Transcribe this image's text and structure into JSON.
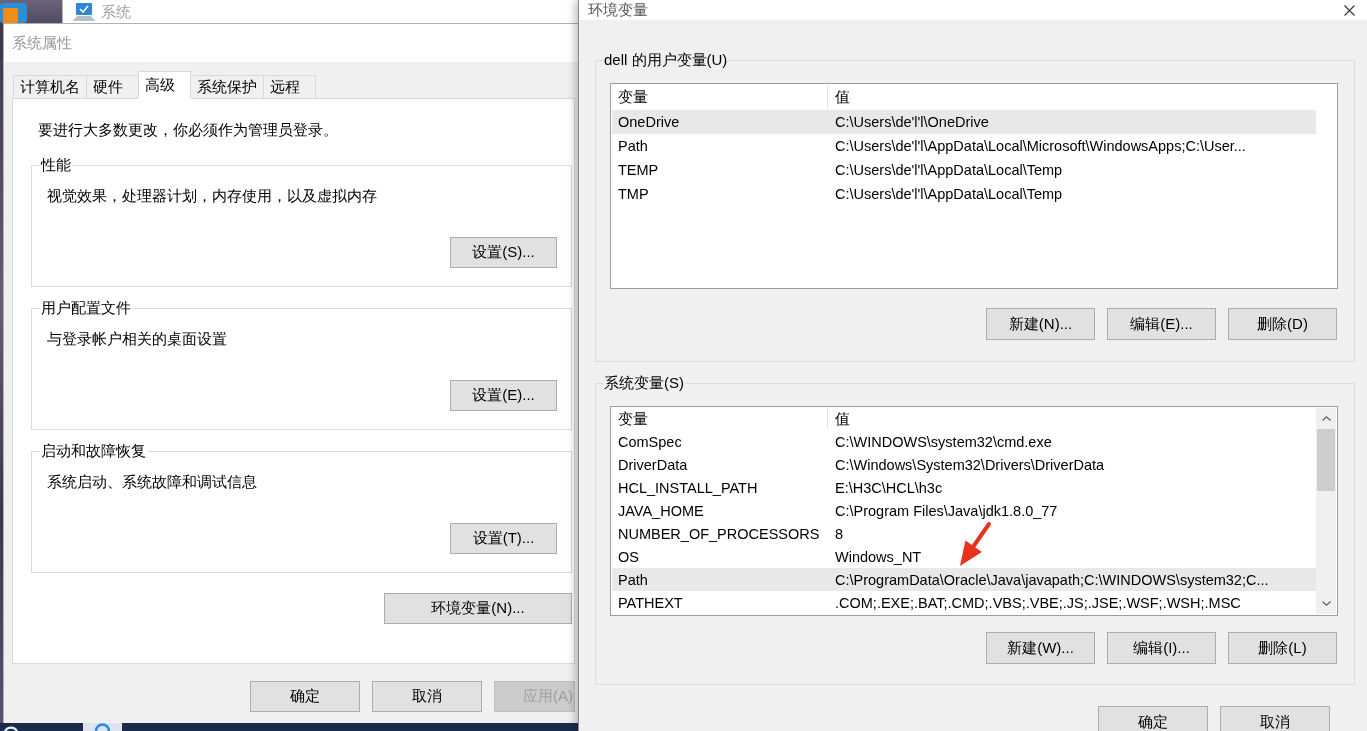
{
  "background_window": {
    "title": "系统"
  },
  "system_properties": {
    "title": "系统属性",
    "tabs": [
      {
        "label": "计算机名",
        "selected": false
      },
      {
        "label": "硬件",
        "selected": false
      },
      {
        "label": "高级",
        "selected": true
      },
      {
        "label": "系统保护",
        "selected": false
      },
      {
        "label": "远程",
        "selected": false
      }
    ],
    "notice": "要进行大多数更改，你必须作为管理员登录。",
    "groups": [
      {
        "title": "性能",
        "description": "视觉效果，处理器计划，内存使用，以及虚拟内存",
        "button": "设置(S)..."
      },
      {
        "title": "用户配置文件",
        "description": "与登录帐户相关的桌面设置",
        "button": "设置(E)..."
      },
      {
        "title": "启动和故障恢复",
        "description": "系统启动、系统故障和调试信息",
        "button": "设置(T)..."
      }
    ],
    "environment_button": "环境变量(N)...",
    "buttons": [
      {
        "label": "确定",
        "disabled": false
      },
      {
        "label": "取消",
        "disabled": false
      },
      {
        "label": "应用(A)",
        "disabled": true
      }
    ]
  },
  "environment_variables": {
    "title": "环境变量",
    "sections": [
      {
        "title": "dell 的用户变量(U)",
        "columns": [
          "变量",
          "值"
        ],
        "rows": [
          {
            "name": "OneDrive",
            "value": "C:\\Users\\de'l'l\\OneDrive",
            "selected": true
          },
          {
            "name": "Path",
            "value": "C:\\Users\\de'l'l\\AppData\\Local\\Microsoft\\WindowsApps;C:\\User...",
            "selected": false
          },
          {
            "name": "TEMP",
            "value": "C:\\Users\\de'l'l\\AppData\\Local\\Temp",
            "selected": false
          },
          {
            "name": "TMP",
            "value": "C:\\Users\\de'l'l\\AppData\\Local\\Temp",
            "selected": false
          }
        ],
        "buttons": [
          "新建(N)...",
          "编辑(E)...",
          "删除(D)"
        ]
      },
      {
        "title": "系统变量(S)",
        "columns": [
          "变量",
          "值"
        ],
        "rows": [
          {
            "name": "ComSpec",
            "value": "C:\\WINDOWS\\system32\\cmd.exe",
            "selected": false
          },
          {
            "name": "DriverData",
            "value": "C:\\Windows\\System32\\Drivers\\DriverData",
            "selected": false
          },
          {
            "name": "HCL_INSTALL_PATH",
            "value": "E:\\H3C\\HCL\\h3c",
            "selected": false
          },
          {
            "name": "JAVA_HOME",
            "value": "C:\\Program Files\\Java\\jdk1.8.0_77",
            "selected": false
          },
          {
            "name": "NUMBER_OF_PROCESSORS",
            "value": "8",
            "selected": false
          },
          {
            "name": "OS",
            "value": "Windows_NT",
            "selected": false
          },
          {
            "name": "Path",
            "value": "C:\\ProgramData\\Oracle\\Java\\javapath;C:\\WINDOWS\\system32;C...",
            "selected": true
          },
          {
            "name": "PATHEXT",
            "value": ".COM;.EXE;.BAT;.CMD;.VBS;.VBE;.JS;.JSE;.WSF;.WSH;.MSC",
            "selected": false
          }
        ],
        "buttons": [
          "新建(W)...",
          "编辑(I)...",
          "删除(L)"
        ]
      }
    ],
    "buttons": [
      "确定",
      "取消"
    ]
  }
}
